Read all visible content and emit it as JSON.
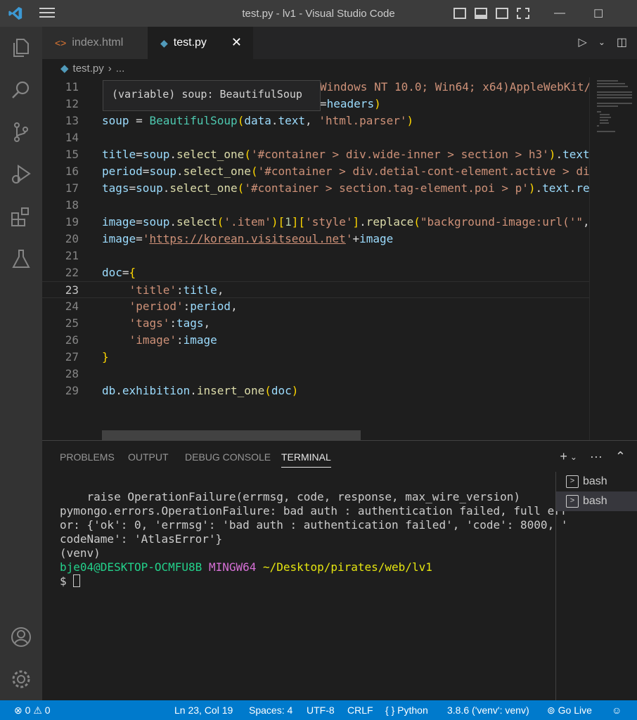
{
  "window": {
    "title": "test.py - lv1 - Visual Studio Code",
    "controls": {
      "minimize": "—",
      "maximize": "☐",
      "close": "✕"
    }
  },
  "tabs": [
    {
      "label": "index.html",
      "icon": "html-file-icon",
      "active": false
    },
    {
      "label": "test.py",
      "icon": "python-file-icon",
      "active": true,
      "close": "✕"
    }
  ],
  "breadcrumb": {
    "file": "test.py",
    "separator": "›",
    "rest": "..."
  },
  "hover": {
    "text": "(variable) soup: BeautifulSoup"
  },
  "editor": {
    "current_line": "23",
    "lines": [
      {
        "num": "11",
        "text": "Windows NT 10.0; Win64; x64)AppleWebKit/"
      },
      {
        "num": "12",
        "text": "=headers)"
      },
      {
        "num": "13",
        "text": "soup = BeautifulSoup(data.text, 'html.parser')"
      },
      {
        "num": "14",
        "text": ""
      },
      {
        "num": "15",
        "text": "title=soup.select_one('#container > div.wide-inner > section > h3').text"
      },
      {
        "num": "16",
        "text": "period=soup.select_one('#container > div.detial-cont-element.active > di"
      },
      {
        "num": "17",
        "text": "tags=soup.select_one('#container > section.tag-element.poi > p').text.re"
      },
      {
        "num": "18",
        "text": ""
      },
      {
        "num": "19",
        "text": "image=soup.select('.item')[1]['style'].replace(\"background-image:url('\","
      },
      {
        "num": "20",
        "text": "image='https://korean.visitseoul.net'+image"
      },
      {
        "num": "21",
        "text": ""
      },
      {
        "num": "22",
        "text": "doc={"
      },
      {
        "num": "23",
        "text": "    'title':title,"
      },
      {
        "num": "24",
        "text": "    'period':period,"
      },
      {
        "num": "25",
        "text": "    'tags':tags,"
      },
      {
        "num": "26",
        "text": "    'image':image"
      },
      {
        "num": "27",
        "text": "}"
      },
      {
        "num": "28",
        "text": ""
      },
      {
        "num": "29",
        "text": "db.exhibition.insert_one(doc)"
      }
    ]
  },
  "panel": {
    "tabs": [
      "PROBLEMS",
      "OUTPUT",
      "DEBUG CONSOLE",
      "TERMINAL"
    ],
    "active_tab": "TERMINAL",
    "actions": {
      "add": "+",
      "dropdown": "⌄",
      "more": "···",
      "maximize": "⌃"
    },
    "terminal_lines": [
      "    raise OperationFailure(errmsg, code, response, max_wire_version)",
      "pymongo.errors.OperationFailure: bad auth : authentication failed, full err",
      "or: {'ok': 0, 'errmsg': 'bad auth : authentication failed', 'code': 8000, '",
      "codeName': 'AtlasError'}",
      "(venv)"
    ],
    "prompt": {
      "user_host": "bje04@DESKTOP-OCMFU8B",
      "shell": "MINGW64",
      "path": "~/Desktop/pirates/web/lv1",
      "symbol": "$"
    },
    "terminals": [
      {
        "label": "bash",
        "selected": false
      },
      {
        "label": "bash",
        "selected": true
      }
    ]
  },
  "statusbar": {
    "errors": "0",
    "warnings": "0",
    "position": "Ln 23, Col 19",
    "spaces": "Spaces: 4",
    "encoding": "UTF-8",
    "eol": "CRLF",
    "language": "Python",
    "interpreter": "3.8.6 ('venv': venv)",
    "golive": "Go Live"
  },
  "colors": {
    "accent": "#007acc",
    "titlebar": "#3c3c3c",
    "activitybar": "#333333",
    "editor_bg": "#1e1e1e"
  }
}
